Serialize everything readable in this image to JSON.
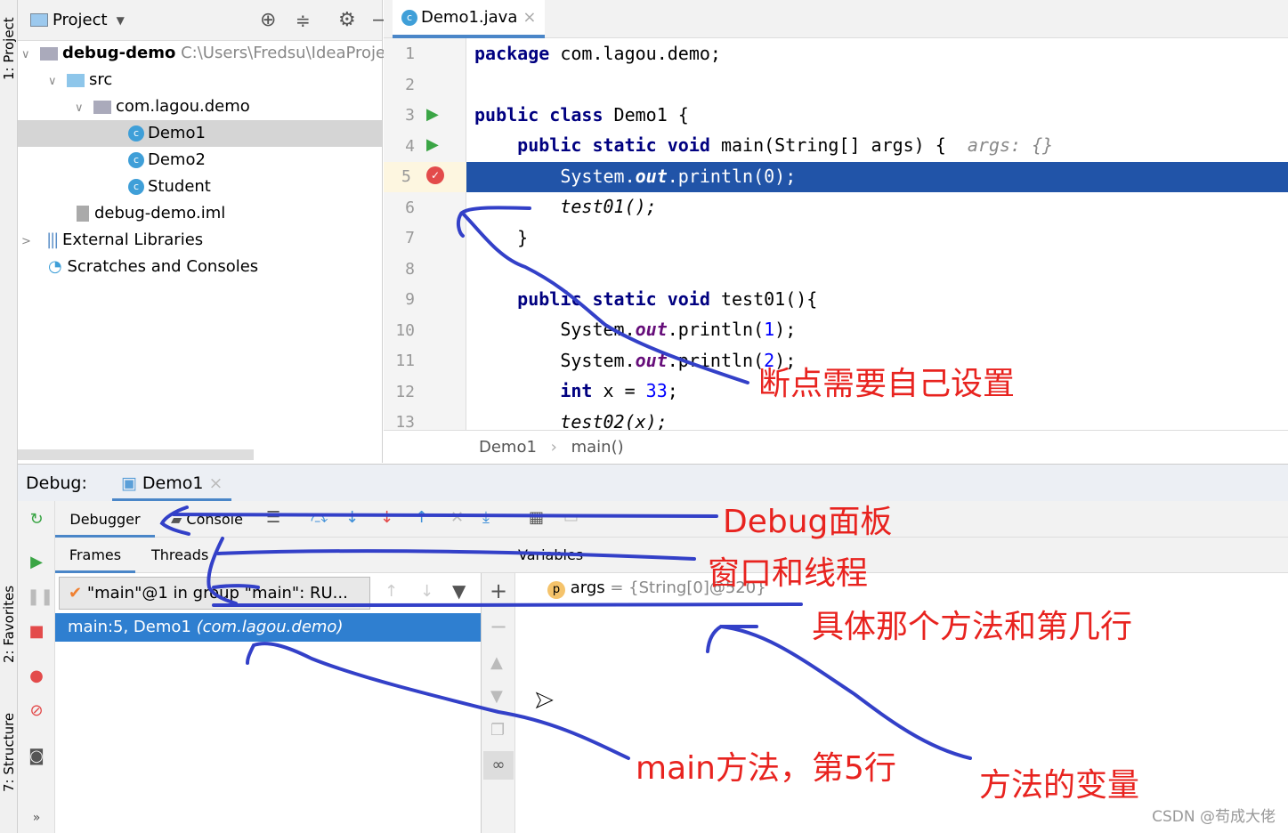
{
  "side_strip": {
    "project": "1: Project",
    "favorites": "2: Favorites",
    "structure": "7: Structure"
  },
  "project": {
    "title": "Project",
    "tree": [
      {
        "label": "debug-demo",
        "path": "C:\\Users\\Fredsu\\IdeaProje",
        "icon": "module-icon"
      },
      {
        "label": "src",
        "icon": "folder-icon"
      },
      {
        "label": "com.lagou.demo",
        "icon": "package-icon"
      },
      {
        "label": "Demo1",
        "icon": "class-icon",
        "selected": true
      },
      {
        "label": "Demo2",
        "icon": "class-icon"
      },
      {
        "label": "Student",
        "icon": "class-icon"
      },
      {
        "label": "debug-demo.iml",
        "icon": "iml-file-icon"
      },
      {
        "label": "External Libraries",
        "icon": "library-icon"
      },
      {
        "label": "Scratches and Consoles",
        "icon": "scratches-icon"
      }
    ]
  },
  "editor": {
    "tab": "Demo1.java",
    "breadcrumb": [
      "Demo1",
      "main()"
    ],
    "lines": [
      "1",
      "2",
      "3",
      "4",
      "5",
      "6",
      "7",
      "8",
      "9",
      "10",
      "11",
      "12",
      "13"
    ],
    "code": {
      "l1a": "package",
      "l1b": " com.lagou.demo;",
      "l3a": "public class",
      "l3b": " Demo1 {",
      "l4a": "    public static void",
      "l4b": " main(String[] args) {  ",
      "l4c": "args: {}",
      "l5a": "        System.",
      "l5b": "out",
      "l5c": ".println(0);",
      "l6": "        test01();",
      "l7": "    }",
      "l9a": "    public static void",
      "l9b": " test01(){",
      "l10a": "        System.",
      "l10b": "out",
      "l10c": ".println(",
      "l10d": "1",
      "l10e": ");",
      "l11a": "        System.",
      "l11b": "out",
      "l11c": ".println(",
      "l11d": "2",
      "l11e": ");",
      "l12a": "        int",
      "l12b": " x = ",
      "l12c": "33",
      "l12d": ";",
      "l13": "        test02(x);"
    },
    "current_line": 5,
    "breakpoint_line": 5
  },
  "debug": {
    "label": "Debug:",
    "tab": "Demo1",
    "tabs": [
      "Debugger",
      "Console"
    ],
    "subtabs": [
      "Frames",
      "Threads"
    ],
    "variables_label": "Variables",
    "thread": "\"main\"@1 in group \"main\": RU...",
    "frame": "main:5, Demo1",
    "frame_pkg": "(com.lagou.demo)",
    "var_name": "args",
    "var_value": " = {String[0]@520}"
  },
  "annotations": [
    "断点需要自己设置",
    "Debug面板",
    "窗口和线程",
    "具体那个方法和第几行",
    "main方法，第5行",
    "方法的变量"
  ],
  "watermark": "CSDN @苟成大佬",
  "colors": {
    "annotation_text": "#e8231f",
    "annotation_ink": "#3340c8",
    "current_line": "#2154a8",
    "selected_frame": "#2f7fd0"
  }
}
